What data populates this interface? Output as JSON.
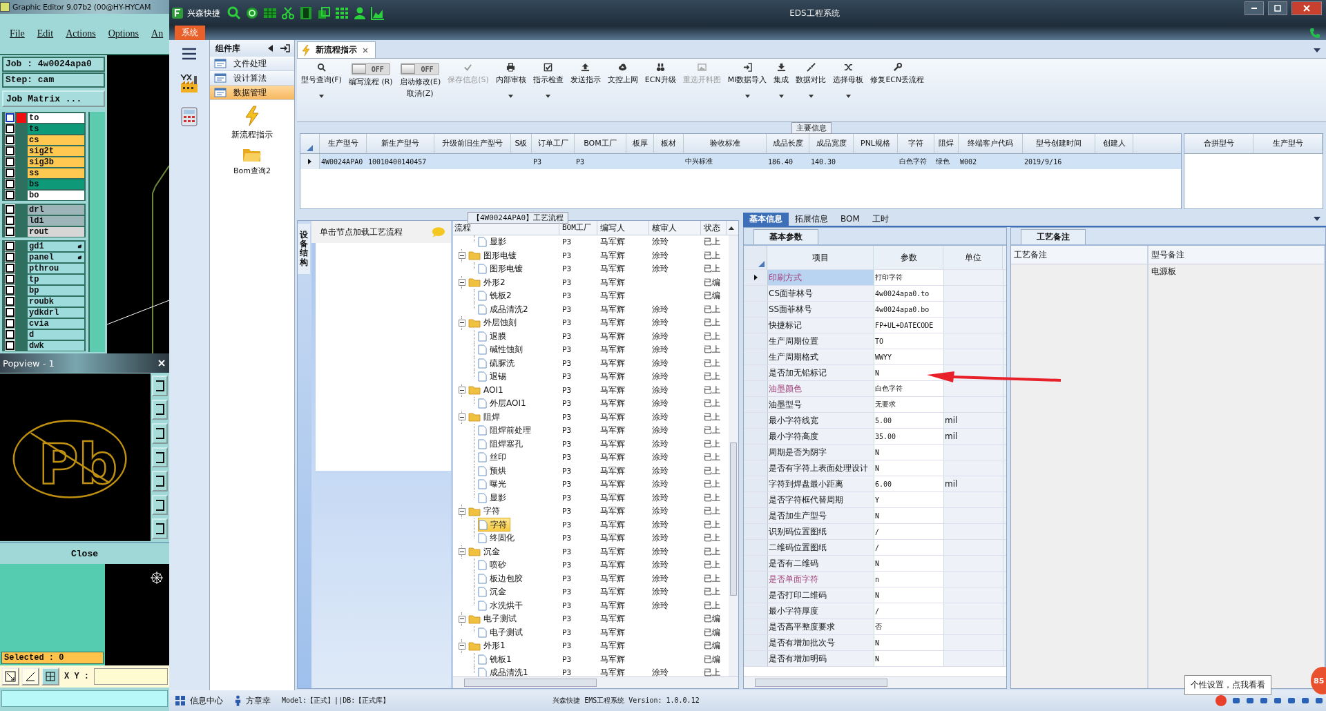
{
  "editor": {
    "title": "Graphic Editor 9.07b2 (00@HY-HYCAM",
    "menu": [
      "File",
      "Edit",
      "Actions",
      "Options",
      "An"
    ],
    "job": "Job : 4w0024apa0",
    "step": "Step: cam",
    "matrix_button": "Job Matrix ...",
    "layer_groups": [
      [
        {
          "name": "to",
          "color": "#ffffff",
          "checked": false,
          "selected": true,
          "flagged": false
        },
        {
          "name": "ts",
          "color": "#0e9a78",
          "checked": false,
          "selected": false,
          "flagged": false
        },
        {
          "name": "cs",
          "color": "#ffc850",
          "checked": false,
          "selected": false,
          "flagged": false
        },
        {
          "name": "sig2t",
          "color": "#ffc850",
          "checked": false,
          "selected": false,
          "flagged": false
        },
        {
          "name": "sig3b",
          "color": "#ffc850",
          "checked": false,
          "selected": false,
          "flagged": false
        },
        {
          "name": "ss",
          "color": "#ffc850",
          "checked": false,
          "selected": false,
          "flagged": false
        },
        {
          "name": "bs",
          "color": "#0e9a78",
          "checked": false,
          "selected": false,
          "flagged": false
        },
        {
          "name": "bo",
          "color": "#ffffff",
          "checked": false,
          "selected": false,
          "flagged": false
        }
      ],
      [
        {
          "name": "drl",
          "color": "#9db5b9",
          "checked": false,
          "selected": false,
          "flagged": false
        },
        {
          "name": "ldi",
          "color": "#9db5b9",
          "checked": false,
          "selected": false,
          "flagged": false
        },
        {
          "name": "rout",
          "color": "#d6d6d6",
          "checked": false,
          "selected": false,
          "flagged": false
        }
      ],
      [
        {
          "name": "gd1",
          "color": "#9edbdc",
          "checked": false,
          "selected": false,
          "flagged": true
        },
        {
          "name": "panel",
          "color": "#9edbdc",
          "checked": false,
          "selected": false,
          "flagged": true
        },
        {
          "name": "pthrou",
          "color": "#9edbdc",
          "checked": false,
          "selected": false,
          "flagged": false
        },
        {
          "name": "tp",
          "color": "#9edbdc",
          "checked": false,
          "selected": false,
          "flagged": false
        },
        {
          "name": "bp",
          "color": "#9edbdc",
          "checked": false,
          "selected": false,
          "flagged": false
        },
        {
          "name": "roubk",
          "color": "#9edbdc",
          "checked": false,
          "selected": false,
          "flagged": false
        },
        {
          "name": "ydkdrl",
          "color": "#9edbdc",
          "checked": false,
          "selected": false,
          "flagged": false
        },
        {
          "name": "cvia",
          "color": "#9edbdc",
          "checked": false,
          "selected": false,
          "flagged": false
        },
        {
          "name": "d",
          "color": "#9edbdc",
          "checked": false,
          "selected": false,
          "flagged": false
        },
        {
          "name": "dwk",
          "color": "#9edbdc",
          "checked": false,
          "selected": false,
          "flagged": false
        }
      ]
    ],
    "popview": {
      "title": "Popview - 1",
      "symbol": "Pb",
      "close_button": "Close"
    },
    "selected_count": "Selected : 0",
    "xy_label": "X Y :"
  },
  "app": {
    "name": "兴森快捷",
    "title": "EDS工程系统",
    "ribbon_tab": "系统"
  },
  "component_panel": {
    "title": "组件库",
    "items": [
      {
        "label": "文件处理",
        "selected": false
      },
      {
        "label": "设计算法",
        "selected": false
      },
      {
        "label": "数据管理",
        "selected": true
      }
    ],
    "shortcuts": [
      "新流程指示",
      "Bom查询2"
    ]
  },
  "document_tab": {
    "label": "新流程指示"
  },
  "toolbar": [
    {
      "kind": "button",
      "label": "型号查询(F)",
      "caret": true,
      "disabled": false
    },
    {
      "kind": "toggle",
      "label": "编写流程 (R)",
      "state_text": "OFF",
      "on": false
    },
    {
      "kind": "toggle",
      "label": "启动修改(E)",
      "sublabel": "取消(Z)",
      "state_text": "OFF",
      "on": false
    },
    {
      "kind": "button",
      "label": "保存信息(S)",
      "caret": false,
      "disabled": true
    },
    {
      "kind": "button",
      "label": "内部审核",
      "caret": true,
      "disabled": false
    },
    {
      "kind": "button",
      "label": "指示检查",
      "caret": true,
      "disabled": false
    },
    {
      "kind": "button",
      "label": "发送指示",
      "caret": false,
      "disabled": false
    },
    {
      "kind": "button",
      "label": "文控上网",
      "caret": false,
      "disabled": false
    },
    {
      "kind": "button",
      "label": "ECN升级",
      "caret": false,
      "disabled": false
    },
    {
      "kind": "button",
      "label": "重选开料图",
      "caret": false,
      "disabled": true
    },
    {
      "kind": "button",
      "label": "MI数据导入",
      "caret": true,
      "disabled": false
    },
    {
      "kind": "button",
      "label": "集成",
      "caret": true,
      "disabled": false
    },
    {
      "kind": "button",
      "label": "数据对比",
      "caret": true,
      "disabled": false
    },
    {
      "kind": "button",
      "label": "选择母板",
      "caret": true,
      "disabled": false
    },
    {
      "kind": "button",
      "label": "修复ECN丢流程",
      "caret": false,
      "disabled": false
    }
  ],
  "main_info": {
    "title": "主要信息",
    "columns": [
      "生产型号",
      "新生产型号",
      "升级前旧生产型号",
      "S板",
      "订单工厂",
      "BOM工厂",
      "板厚",
      "板材",
      "验收标准",
      "成品长度",
      "成品宽度",
      "PNL规格",
      "字符",
      "阻焊",
      "终端客户代码",
      "型号创建时间",
      "创建人"
    ],
    "rows": [
      {
        "selected": true,
        "cells": [
          "4W0024APA0",
          "10010400140457",
          null,
          null,
          "P3",
          "P3",
          null,
          null,
          "中兴标准",
          "186.40",
          "140.30",
          null,
          "白色字符",
          "绿色",
          "W002",
          "2019/9/16",
          null
        ]
      }
    ],
    "side_columns": [
      "合拼型号",
      "生产型号"
    ]
  },
  "process": {
    "title": "【4W0024APA0】工艺流程",
    "side_tab": "设备结构",
    "hint": "单击节点加载工艺流程",
    "columns": [
      "流程",
      "BOM工厂",
      "编写人",
      "核审人",
      "状态"
    ],
    "tree": [
      {
        "children": [
          {
            "name": "显影",
            "bom": "P3",
            "writer": "马军辉",
            "reviewer": "涂玲",
            "status": "已上",
            "selected": false
          }
        ]
      },
      {
        "name": "图形电镀",
        "bom": "P3",
        "writer": "马军辉",
        "reviewer": "涂玲",
        "status": "已上",
        "expanded": true,
        "children": [
          {
            "name": "图形电镀",
            "bom": "P3",
            "writer": "马军辉",
            "reviewer": "涂玲",
            "status": "已上",
            "selected": false
          }
        ]
      },
      {
        "name": "外形2",
        "bom": "P3",
        "writer": "马军辉",
        "status": "已编",
        "expanded": true,
        "children": [
          {
            "name": "铣板2",
            "bom": "P3",
            "writer": "马军辉",
            "status": "已编",
            "selected": false
          },
          {
            "name": "成品清洗2",
            "bom": "P3",
            "writer": "马军辉",
            "reviewer": "涂玲",
            "status": "已上",
            "selected": false
          }
        ]
      },
      {
        "name": "外层蚀刻",
        "bom": "P3",
        "writer": "马军辉",
        "reviewer": "涂玲",
        "status": "已上",
        "expanded": true,
        "children": [
          {
            "name": "退膜",
            "bom": "P3",
            "writer": "马军辉",
            "reviewer": "涂玲",
            "status": "已上",
            "selected": false
          },
          {
            "name": "碱性蚀刻",
            "bom": "P3",
            "writer": "马军辉",
            "reviewer": "涂玲",
            "status": "已上",
            "selected": false
          },
          {
            "name": "硫脲洗",
            "bom": "P3",
            "writer": "马军辉",
            "reviewer": "涂玲",
            "status": "已上",
            "selected": false
          },
          {
            "name": "退锡",
            "bom": "P3",
            "writer": "马军辉",
            "reviewer": "涂玲",
            "status": "已上",
            "selected": false
          }
        ]
      },
      {
        "name": "AOI1",
        "bom": "P3",
        "writer": "马军辉",
        "reviewer": "涂玲",
        "status": "已上",
        "expanded": true,
        "children": [
          {
            "name": "外层AOI1",
            "bom": "P3",
            "writer": "马军辉",
            "reviewer": "涂玲",
            "status": "已上",
            "selected": false
          }
        ]
      },
      {
        "name": "阻焊",
        "bom": "P3",
        "writer": "马军辉",
        "reviewer": "涂玲",
        "status": "已上",
        "expanded": true,
        "children": [
          {
            "name": "阻焊前处理",
            "bom": "P3",
            "writer": "马军辉",
            "reviewer": "涂玲",
            "status": "已上",
            "selected": false
          },
          {
            "name": "阻焊塞孔",
            "bom": "P3",
            "writer": "马军辉",
            "reviewer": "涂玲",
            "status": "已上",
            "selected": false
          },
          {
            "name": "丝印",
            "bom": "P3",
            "writer": "马军辉",
            "reviewer": "涂玲",
            "status": "已上",
            "selected": false
          },
          {
            "name": "预烘",
            "bom": "P3",
            "writer": "马军辉",
            "reviewer": "涂玲",
            "status": "已上",
            "selected": false
          },
          {
            "name": "曝光",
            "bom": "P3",
            "writer": "马军辉",
            "reviewer": "涂玲",
            "status": "已上",
            "selected": false
          },
          {
            "name": "显影",
            "bom": "P3",
            "writer": "马军辉",
            "reviewer": "涂玲",
            "status": "已上",
            "selected": false
          }
        ]
      },
      {
        "name": "字符",
        "bom": "P3",
        "writer": "马军辉",
        "reviewer": "涂玲",
        "status": "已上",
        "expanded": true,
        "children": [
          {
            "name": "字符",
            "bom": "P3",
            "writer": "马军辉",
            "reviewer": "涂玲",
            "status": "已上",
            "selected": true
          },
          {
            "name": "终固化",
            "bom": "P3",
            "writer": "马军辉",
            "reviewer": "涂玲",
            "status": "已上",
            "selected": false
          }
        ]
      },
      {
        "name": "沉金",
        "bom": "P3",
        "writer": "马军辉",
        "reviewer": "涂玲",
        "status": "已上",
        "expanded": true,
        "children": [
          {
            "name": "喷砂",
            "bom": "P3",
            "writer": "马军辉",
            "reviewer": "涂玲",
            "status": "已上",
            "selected": false
          },
          {
            "name": "板边包胶",
            "bom": "P3",
            "writer": "马军辉",
            "reviewer": "涂玲",
            "status": "已上",
            "selected": false
          },
          {
            "name": "沉金",
            "bom": "P3",
            "writer": "马军辉",
            "reviewer": "涂玲",
            "status": "已上",
            "selected": false
          },
          {
            "name": "水洗烘干",
            "bom": "P3",
            "writer": "马军辉",
            "reviewer": "涂玲",
            "status": "已上",
            "selected": false
          }
        ]
      },
      {
        "name": "电子测试",
        "bom": "P3",
        "writer": "马军辉",
        "status": "已编",
        "expanded": true,
        "children": [
          {
            "name": "电子测试",
            "bom": "P3",
            "writer": "马军辉",
            "status": "已编",
            "selected": false
          }
        ]
      },
      {
        "name": "外形1",
        "bom": "P3",
        "writer": "马军辉",
        "status": "已编",
        "expanded": true,
        "children": [
          {
            "name": "铣板1",
            "bom": "P3",
            "writer": "马军辉",
            "status": "已编",
            "selected": false
          },
          {
            "name": "成品清洗1",
            "bom": "P3",
            "writer": "马军辉",
            "reviewer": "涂玲",
            "status": "已上",
            "selected": false
          }
        ]
      }
    ]
  },
  "detail_tabs": [
    {
      "label": "基本信息",
      "selected": true
    },
    {
      "label": "拓展信息",
      "selected": false
    },
    {
      "label": "BOM",
      "selected": false
    },
    {
      "label": "工时",
      "selected": false
    }
  ],
  "params": {
    "tab": "基本参数",
    "columns": [
      "项目",
      "参数",
      "单位"
    ],
    "rows": [
      {
        "item": "印刷方式",
        "value": "打印字符",
        "highlight": true,
        "selected": true
      },
      {
        "item": "CS面菲林号",
        "value": "4w0024apa0.to",
        "highlight": false,
        "selected": false
      },
      {
        "item": "SS面菲林号",
        "value": "4w0024apa0.bo",
        "highlight": false,
        "selected": false
      },
      {
        "item": "快捷标记",
        "value": "FP+UL+DATECODE",
        "highlight": false,
        "selected": false
      },
      {
        "item": "生产周期位置",
        "value": "TO",
        "highlight": false,
        "selected": false
      },
      {
        "item": "生产周期格式",
        "value": "WWYY",
        "highlight": false,
        "selected": false
      },
      {
        "item": "是否加无铅标记",
        "value": "N",
        "highlight": false,
        "selected": false
      },
      {
        "item": "油墨颜色",
        "value": "白色字符",
        "highlight": true,
        "selected": false
      },
      {
        "item": "油墨型号",
        "value": "无要求",
        "highlight": false,
        "selected": false
      },
      {
        "item": "最小字符线宽",
        "value": "5.00",
        "unit": "mil",
        "highlight": false,
        "selected": false
      },
      {
        "item": "最小字符高度",
        "value": "35.00",
        "unit": "mil",
        "highlight": false,
        "selected": false
      },
      {
        "item": "周期是否为阴字",
        "value": "N",
        "highlight": false,
        "selected": false
      },
      {
        "item": "是否有字符上表面处理设计",
        "value": "N",
        "highlight": false,
        "selected": false
      },
      {
        "item": "字符到焊盘最小距离",
        "value": "6.00",
        "unit": "mil",
        "highlight": false,
        "selected": false
      },
      {
        "item": "是否字符框代替周期",
        "value": "Y",
        "highlight": false,
        "selected": false
      },
      {
        "item": "是否加生产型号",
        "value": "N",
        "highlight": false,
        "selected": false
      },
      {
        "item": "识别码位置图纸",
        "value": "/",
        "highlight": false,
        "selected": false
      },
      {
        "item": "二维码位置图纸",
        "value": "/",
        "highlight": false,
        "selected": false
      },
      {
        "item": "是否有二维码",
        "value": "N",
        "highlight": false,
        "selected": false
      },
      {
        "item": "是否单面字符",
        "value": "n",
        "highlight": true,
        "selected": false
      },
      {
        "item": "是否打印二维码",
        "value": "N",
        "highlight": false,
        "selected": false
      },
      {
        "item": "最小字符厚度",
        "value": "/",
        "highlight": false,
        "selected": false
      },
      {
        "item": "是否高平整度要求",
        "value": "否",
        "highlight": false,
        "selected": false
      },
      {
        "item": "是否有增加批次号",
        "value": "N",
        "highlight": false,
        "selected": false
      },
      {
        "item": "是否有增加明码",
        "value": "N",
        "highlight": false,
        "selected": false
      }
    ]
  },
  "notes": {
    "tab": "工艺备注",
    "columns": [
      "工艺备注",
      "型号备注"
    ],
    "model_note": "电源板"
  },
  "tooltip": "个性设置，点我看看",
  "badge": "85",
  "status_bar": {
    "info_center": "信息中心",
    "user": "方章幸",
    "model": "Model:【正式】||DB:【正式库】",
    "version": "兴森快捷 EMS工程系统 Version: 1.0.0.12"
  }
}
